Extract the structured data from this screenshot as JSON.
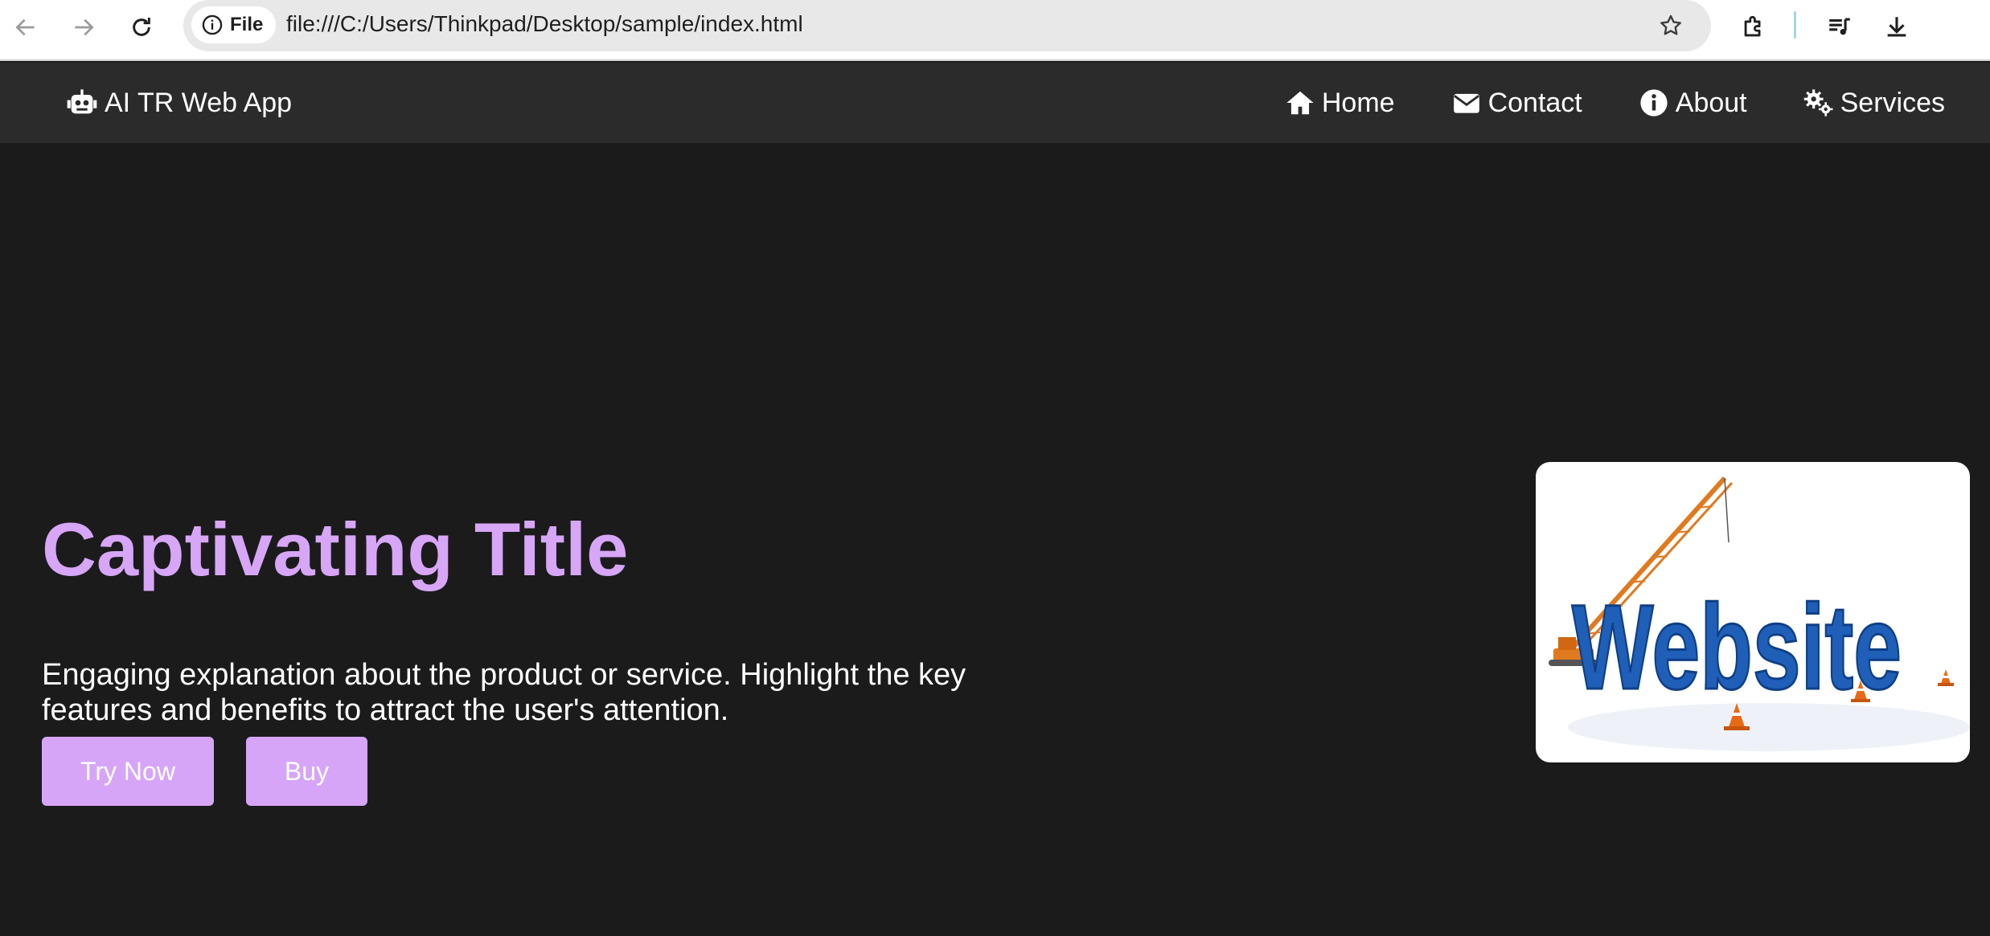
{
  "browser": {
    "site_chip_label": "File",
    "url": "file:///C:/Users/Thinkpad/Desktop/sample/index.html"
  },
  "navbar": {
    "brand": {
      "icon": "robot-icon",
      "label": "AI TR Web App"
    },
    "links": [
      {
        "icon": "home-icon",
        "label": "Home"
      },
      {
        "icon": "envelope-icon",
        "label": "Contact"
      },
      {
        "icon": "info-icon",
        "label": "About"
      },
      {
        "icon": "gears-icon",
        "label": "Services"
      }
    ]
  },
  "hero": {
    "title": "Captivating Title",
    "description": "Engaging explanation about the product or service. Highlight the key features and benefits to attract the user's attention.",
    "buttons": [
      {
        "label": "Try Now"
      },
      {
        "label": "Buy"
      }
    ],
    "image_word": "Website"
  },
  "colors": {
    "page_background": "#1b1b1b",
    "navbar_background": "#2b2b2b",
    "accent": "#d7a6f7",
    "button_background": "#d6a5f8",
    "image_text_blue": "#1f5fb8"
  }
}
